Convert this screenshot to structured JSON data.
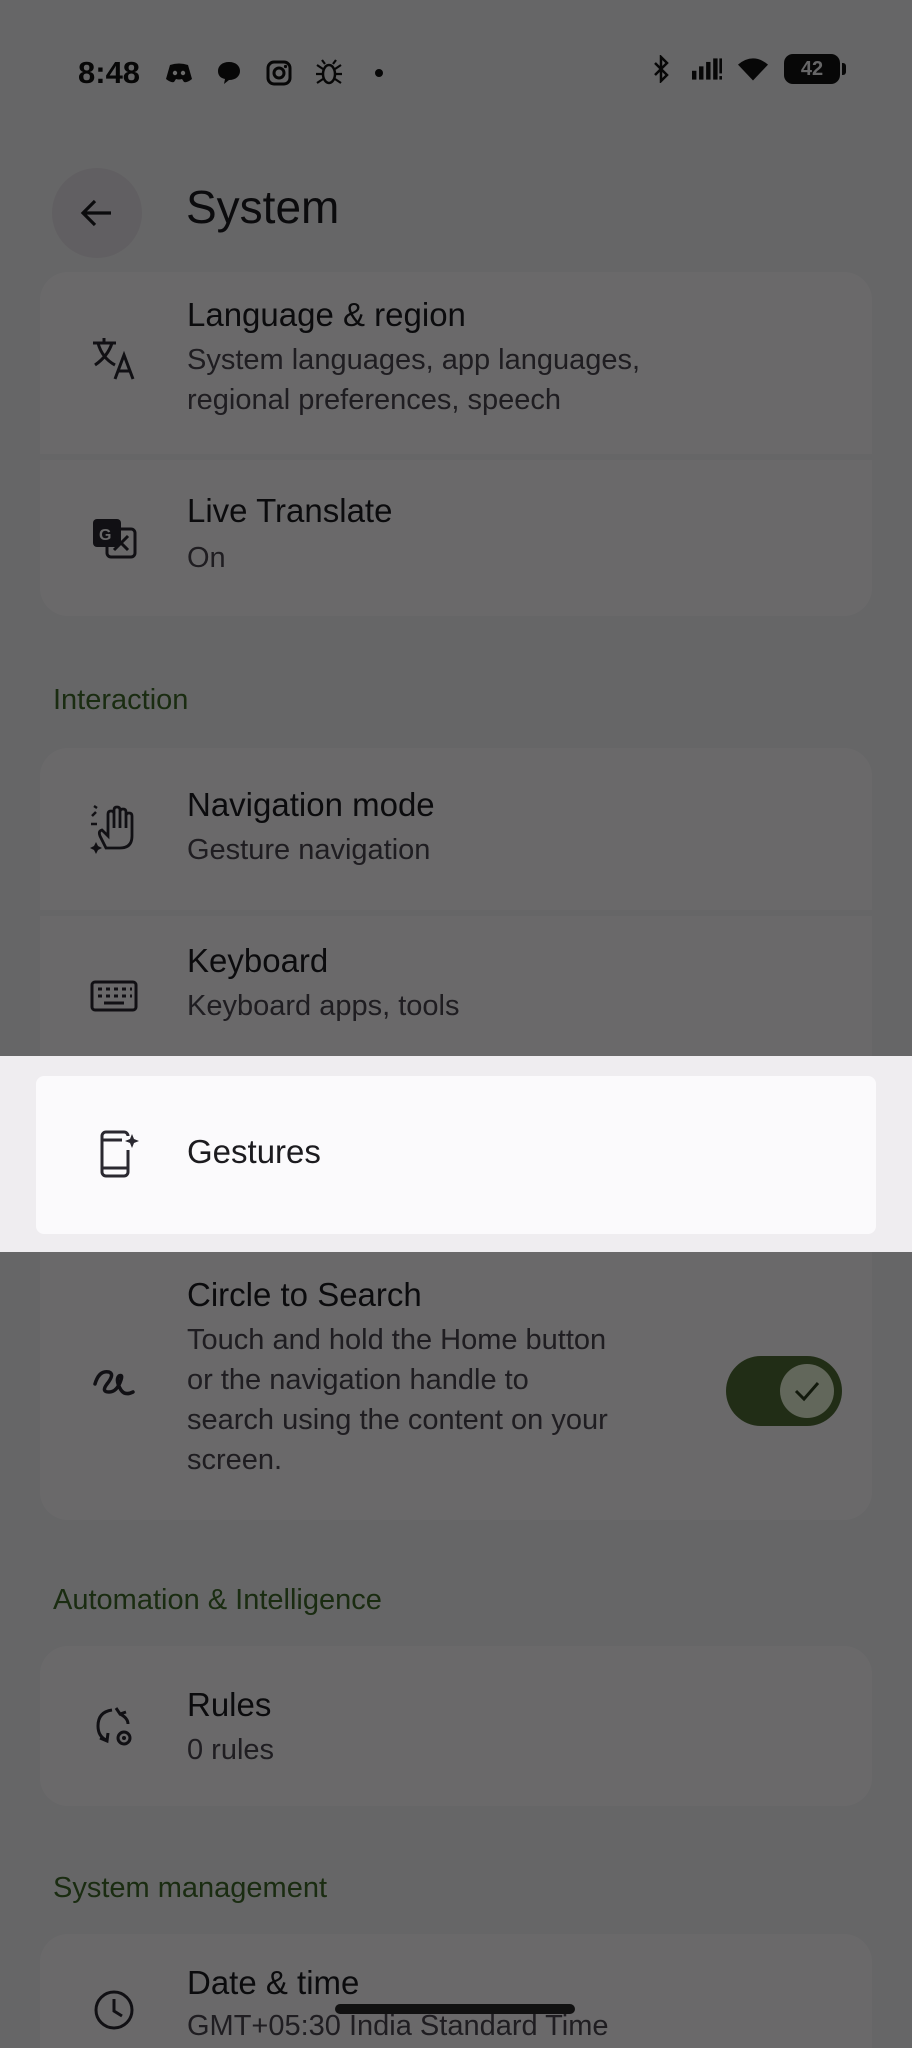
{
  "status_bar": {
    "time": "8:48",
    "left_icons": [
      "discord-icon",
      "chat-bubble-icon",
      "instagram-icon",
      "bug-icon",
      "dot-icon"
    ],
    "right_icons": [
      "bluetooth-icon",
      "signal-icon",
      "wifi-icon"
    ],
    "battery": "42"
  },
  "header": {
    "title": "System"
  },
  "sections": {
    "top": {
      "items": [
        {
          "title": "Language & region",
          "subtitle_line1": "System languages, app languages,",
          "subtitle_line2": "regional preferences, speech",
          "icon": "translate-icon"
        },
        {
          "title": "Live Translate",
          "subtitle": "On",
          "icon": "live-translate-icon"
        }
      ]
    },
    "interaction": {
      "header": "Interaction",
      "items": [
        {
          "title": "Navigation mode",
          "subtitle": "Gesture navigation",
          "icon": "gesture-hand-icon"
        },
        {
          "title": "Keyboard",
          "subtitle": "Keyboard apps, tools",
          "icon": "keyboard-icon"
        },
        {
          "title": "Gestures",
          "icon": "phone-sparkle-icon"
        },
        {
          "title": "Circle to Search",
          "subtitle_line1": "Touch and hold the Home button",
          "subtitle_line2": "or the navigation handle to",
          "subtitle_line3": "search using the content on your",
          "subtitle_line4": "screen.",
          "icon": "circle-search-icon",
          "toggle_on": true
        }
      ]
    },
    "automation": {
      "header": "Automation & Intelligence",
      "items": [
        {
          "title": "Rules",
          "subtitle": "0 rules",
          "icon": "rules-icon"
        }
      ]
    },
    "system_management": {
      "header": "System management",
      "items": [
        {
          "title": "Date & time",
          "subtitle": "GMT+05:30 India Standard Time",
          "icon": "clock-icon"
        }
      ]
    }
  },
  "colors": {
    "background": "#f4f2f5",
    "card": "#fcfbfd",
    "section_header": "#3e6a2a",
    "toggle_on": "#4f6c35",
    "overlay": "rgba(0,0,0,0.58)"
  }
}
